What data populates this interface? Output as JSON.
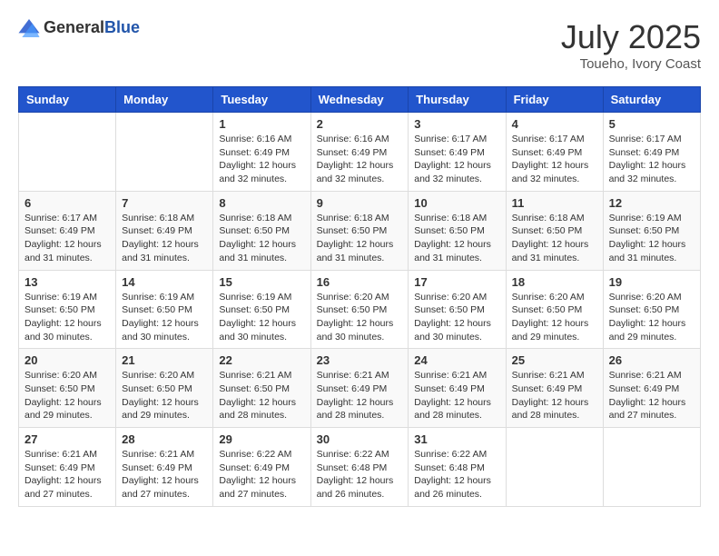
{
  "header": {
    "logo_general": "General",
    "logo_blue": "Blue",
    "month_title": "July 2025",
    "location": "Toueho, Ivory Coast"
  },
  "weekdays": [
    "Sunday",
    "Monday",
    "Tuesday",
    "Wednesday",
    "Thursday",
    "Friday",
    "Saturday"
  ],
  "weeks": [
    [
      {
        "day": "",
        "info": ""
      },
      {
        "day": "",
        "info": ""
      },
      {
        "day": "1",
        "info": "Sunrise: 6:16 AM\nSunset: 6:49 PM\nDaylight: 12 hours and 32 minutes."
      },
      {
        "day": "2",
        "info": "Sunrise: 6:16 AM\nSunset: 6:49 PM\nDaylight: 12 hours and 32 minutes."
      },
      {
        "day": "3",
        "info": "Sunrise: 6:17 AM\nSunset: 6:49 PM\nDaylight: 12 hours and 32 minutes."
      },
      {
        "day": "4",
        "info": "Sunrise: 6:17 AM\nSunset: 6:49 PM\nDaylight: 12 hours and 32 minutes."
      },
      {
        "day": "5",
        "info": "Sunrise: 6:17 AM\nSunset: 6:49 PM\nDaylight: 12 hours and 32 minutes."
      }
    ],
    [
      {
        "day": "6",
        "info": "Sunrise: 6:17 AM\nSunset: 6:49 PM\nDaylight: 12 hours and 31 minutes."
      },
      {
        "day": "7",
        "info": "Sunrise: 6:18 AM\nSunset: 6:49 PM\nDaylight: 12 hours and 31 minutes."
      },
      {
        "day": "8",
        "info": "Sunrise: 6:18 AM\nSunset: 6:50 PM\nDaylight: 12 hours and 31 minutes."
      },
      {
        "day": "9",
        "info": "Sunrise: 6:18 AM\nSunset: 6:50 PM\nDaylight: 12 hours and 31 minutes."
      },
      {
        "day": "10",
        "info": "Sunrise: 6:18 AM\nSunset: 6:50 PM\nDaylight: 12 hours and 31 minutes."
      },
      {
        "day": "11",
        "info": "Sunrise: 6:18 AM\nSunset: 6:50 PM\nDaylight: 12 hours and 31 minutes."
      },
      {
        "day": "12",
        "info": "Sunrise: 6:19 AM\nSunset: 6:50 PM\nDaylight: 12 hours and 31 minutes."
      }
    ],
    [
      {
        "day": "13",
        "info": "Sunrise: 6:19 AM\nSunset: 6:50 PM\nDaylight: 12 hours and 30 minutes."
      },
      {
        "day": "14",
        "info": "Sunrise: 6:19 AM\nSunset: 6:50 PM\nDaylight: 12 hours and 30 minutes."
      },
      {
        "day": "15",
        "info": "Sunrise: 6:19 AM\nSunset: 6:50 PM\nDaylight: 12 hours and 30 minutes."
      },
      {
        "day": "16",
        "info": "Sunrise: 6:20 AM\nSunset: 6:50 PM\nDaylight: 12 hours and 30 minutes."
      },
      {
        "day": "17",
        "info": "Sunrise: 6:20 AM\nSunset: 6:50 PM\nDaylight: 12 hours and 30 minutes."
      },
      {
        "day": "18",
        "info": "Sunrise: 6:20 AM\nSunset: 6:50 PM\nDaylight: 12 hours and 29 minutes."
      },
      {
        "day": "19",
        "info": "Sunrise: 6:20 AM\nSunset: 6:50 PM\nDaylight: 12 hours and 29 minutes."
      }
    ],
    [
      {
        "day": "20",
        "info": "Sunrise: 6:20 AM\nSunset: 6:50 PM\nDaylight: 12 hours and 29 minutes."
      },
      {
        "day": "21",
        "info": "Sunrise: 6:20 AM\nSunset: 6:50 PM\nDaylight: 12 hours and 29 minutes."
      },
      {
        "day": "22",
        "info": "Sunrise: 6:21 AM\nSunset: 6:50 PM\nDaylight: 12 hours and 28 minutes."
      },
      {
        "day": "23",
        "info": "Sunrise: 6:21 AM\nSunset: 6:49 PM\nDaylight: 12 hours and 28 minutes."
      },
      {
        "day": "24",
        "info": "Sunrise: 6:21 AM\nSunset: 6:49 PM\nDaylight: 12 hours and 28 minutes."
      },
      {
        "day": "25",
        "info": "Sunrise: 6:21 AM\nSunset: 6:49 PM\nDaylight: 12 hours and 28 minutes."
      },
      {
        "day": "26",
        "info": "Sunrise: 6:21 AM\nSunset: 6:49 PM\nDaylight: 12 hours and 27 minutes."
      }
    ],
    [
      {
        "day": "27",
        "info": "Sunrise: 6:21 AM\nSunset: 6:49 PM\nDaylight: 12 hours and 27 minutes."
      },
      {
        "day": "28",
        "info": "Sunrise: 6:21 AM\nSunset: 6:49 PM\nDaylight: 12 hours and 27 minutes."
      },
      {
        "day": "29",
        "info": "Sunrise: 6:22 AM\nSunset: 6:49 PM\nDaylight: 12 hours and 27 minutes."
      },
      {
        "day": "30",
        "info": "Sunrise: 6:22 AM\nSunset: 6:48 PM\nDaylight: 12 hours and 26 minutes."
      },
      {
        "day": "31",
        "info": "Sunrise: 6:22 AM\nSunset: 6:48 PM\nDaylight: 12 hours and 26 minutes."
      },
      {
        "day": "",
        "info": ""
      },
      {
        "day": "",
        "info": ""
      }
    ]
  ]
}
